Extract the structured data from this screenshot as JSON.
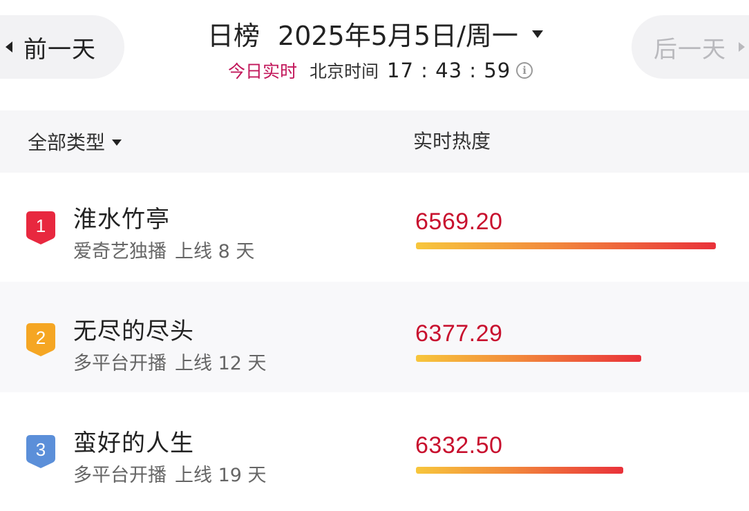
{
  "header": {
    "prev_label": "前一天",
    "next_label": "后一天",
    "rank_label": "日榜",
    "date_label": "2025年5月5日/周一",
    "live_tag": "今日实时",
    "beijing_label": "北京时间",
    "time": "17 : 43 : 59",
    "info_glyph": "i"
  },
  "columns": {
    "filter_label": "全部类型",
    "heat_label": "实时热度"
  },
  "rankings": [
    {
      "rank": "1",
      "title": "淮水竹亭",
      "platform": "爱奇艺独播",
      "online": "上线 8 天",
      "heat": "6569.20",
      "heat_value": 6569.2,
      "badge_color": "#e8283f"
    },
    {
      "rank": "2",
      "title": "无尽的尽头",
      "platform": "多平台开播",
      "online": "上线 12 天",
      "heat": "6377.29",
      "heat_value": 6377.29,
      "badge_color": "#f5a623"
    },
    {
      "rank": "3",
      "title": "蛮好的人生",
      "platform": "多平台开播",
      "online": "上线 19 天",
      "heat": "6332.50",
      "heat_value": 6332.5,
      "badge_color": "#5b8fd9"
    }
  ]
}
